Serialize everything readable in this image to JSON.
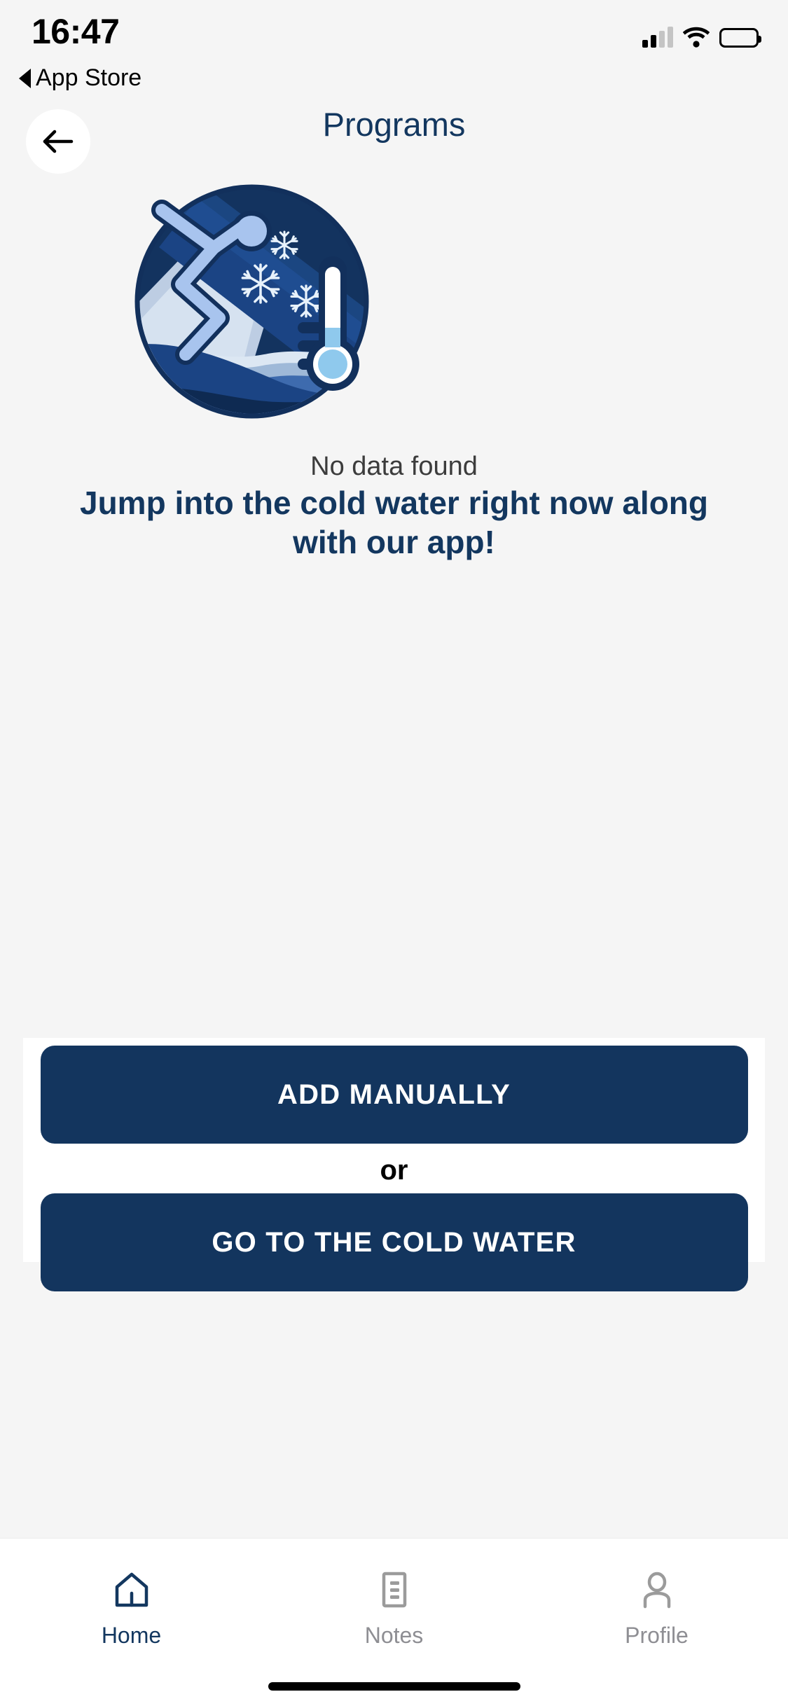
{
  "status_bar": {
    "time": "16:47",
    "return_label": "App Store",
    "return_icon": "back-triangle-icon",
    "signal_icon": "cellular-signal-icon",
    "signal_bars_filled": 2,
    "signal_bars_total": 4,
    "wifi_icon": "wifi-icon",
    "battery_icon": "battery-icon",
    "battery_level": 100
  },
  "header": {
    "title": "Programs",
    "back_button_icon": "arrow-left-icon",
    "title_color": "#13375F"
  },
  "illustration": {
    "name": "cold-water-diver-illustration",
    "alt": "Person jumping into cold water with snowflakes and thermometer",
    "colors": {
      "dark_navy": "#12305C",
      "mid_blue": "#1E4A8C",
      "deep_blue": "#1B4484",
      "light_periwinkle": "#A8C4EE",
      "pale_blue": "#C6D6EA",
      "ice_white": "#E4EDF7",
      "thermometer_bulb": "#8FC9ED",
      "snowflake": "#E8F2FB"
    },
    "snowflake_count": 3,
    "thermometer": "thermometer-icon"
  },
  "empty_state": {
    "message": "No data found",
    "headline": "Jump into the cold water right now along with our app!"
  },
  "actions": {
    "primary_label": "ADD MANUALLY",
    "divider_label": "or",
    "secondary_label": "GO TO THE COLD WATER",
    "button_color": "#13355E",
    "button_text_color": "#FFFFFF"
  },
  "tab_bar": {
    "items": [
      {
        "label": "Home",
        "icon": "home-icon",
        "active": true,
        "color": "#13375F"
      },
      {
        "label": "Notes",
        "icon": "notes-icon",
        "active": false,
        "color": "#8E8E93"
      },
      {
        "label": "Profile",
        "icon": "profile-icon",
        "active": false,
        "color": "#8E8E93"
      }
    ]
  }
}
